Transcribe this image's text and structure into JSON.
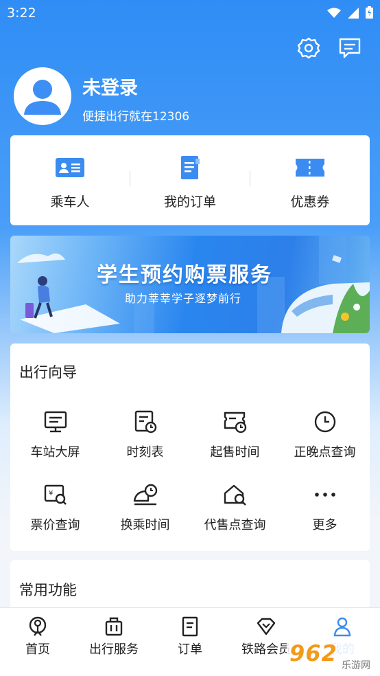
{
  "status_bar": {
    "time": "3:22"
  },
  "profile": {
    "name": "未登录",
    "subtitle": "便捷出行就在12306"
  },
  "quick_actions": [
    {
      "label": "乘车人",
      "icon": "passenger-card-icon"
    },
    {
      "label": "我的订单",
      "icon": "order-document-icon"
    },
    {
      "label": "优惠券",
      "icon": "coupon-icon"
    }
  ],
  "banner": {
    "title": "学生预约购票服务",
    "subtitle": "助力莘莘学子逐梦前行"
  },
  "travel_guide": {
    "title": "出行向导",
    "items": [
      {
        "label": "车站大屏",
        "icon": "station-screen-icon"
      },
      {
        "label": "时刻表",
        "icon": "timetable-icon"
      },
      {
        "label": "起售时间",
        "icon": "sale-time-icon"
      },
      {
        "label": "正晚点查询",
        "icon": "clock-icon"
      },
      {
        "label": "票价查询",
        "icon": "fare-search-icon"
      },
      {
        "label": "换乘时间",
        "icon": "transfer-train-icon"
      },
      {
        "label": "代售点查询",
        "icon": "agency-search-icon"
      },
      {
        "label": "更多",
        "icon": "more-dots-icon"
      }
    ]
  },
  "common_functions": {
    "title": "常用功能"
  },
  "bottom_nav": [
    {
      "label": "首页",
      "icon": "home-train-icon"
    },
    {
      "label": "出行服务",
      "icon": "luggage-icon"
    },
    {
      "label": "订单",
      "icon": "order-icon"
    },
    {
      "label": "铁路会员",
      "icon": "diamond-icon"
    },
    {
      "label": "我的",
      "icon": "person-icon"
    }
  ],
  "watermark": {
    "brand": "962",
    "site": "乐游网"
  },
  "colors": {
    "primary": "#2f8df5",
    "accent_blue": "#3b8cf0",
    "watermark_orange": "#f39a1b"
  }
}
